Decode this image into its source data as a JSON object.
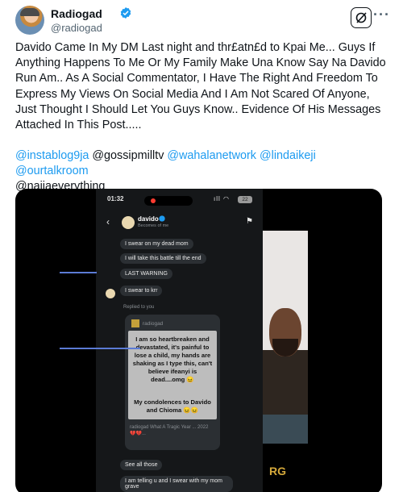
{
  "header": {
    "name": "Radiogad",
    "handle": "@radiogad"
  },
  "tweet": {
    "text": "Davido Came In My DM Last night and thr£atn£d to Kpai Me... Guys If Anything Happens To Me Or My Family Make Una Know Say Na Davido Run Am.. As A Social Commentator,  I Have The Right And Freedom To Express My Views On Social Media And I Am Not Scared Of Anyone, Just Thought I Should Let You Guys Know.. Evidence Of His Messages Attached In This Post.....",
    "mentions": [
      {
        "text": "@instablog9ja",
        "link": true
      },
      {
        "text": "@gossipmilltv",
        "link": false
      },
      {
        "text": "@wahalanetwork",
        "link": true
      },
      {
        "text": "@lindaikeji",
        "link": true
      },
      {
        "text": "@ourtalkroom",
        "link": true
      },
      {
        "text": "@naijaeverything",
        "link": false
      }
    ]
  },
  "screenshot": {
    "status_time": "01:32",
    "battery": "22",
    "contact_name": "davido",
    "contact_sub": "Becomes of me",
    "messages": [
      "I swear on my dead mom",
      "I will take this battle till the end",
      "LAST WARNING",
      "I swear to krr"
    ],
    "replied_label": "Replied to you",
    "quoted_handle": "radiogad",
    "quoted_text": "I am so heartbreaken and devastated, it's painful to lose a child, my hands are shaking as I type this, can't believe ifeanyi is dead....omg 😖",
    "quoted_text2": "My condolences to Davido and Chioma 😖😖",
    "quoted_footer": "radiogad What A Tragic Year ... 2022 💔💔...",
    "later_messages": [
      "See all those",
      "I am telling u and I swear with my mom grave"
    ],
    "photo_brand": "RG"
  },
  "colors": {
    "link": "#1d9bf0",
    "verified": "#1d9bf0",
    "text": "#0f1419",
    "muted": "#536471"
  }
}
